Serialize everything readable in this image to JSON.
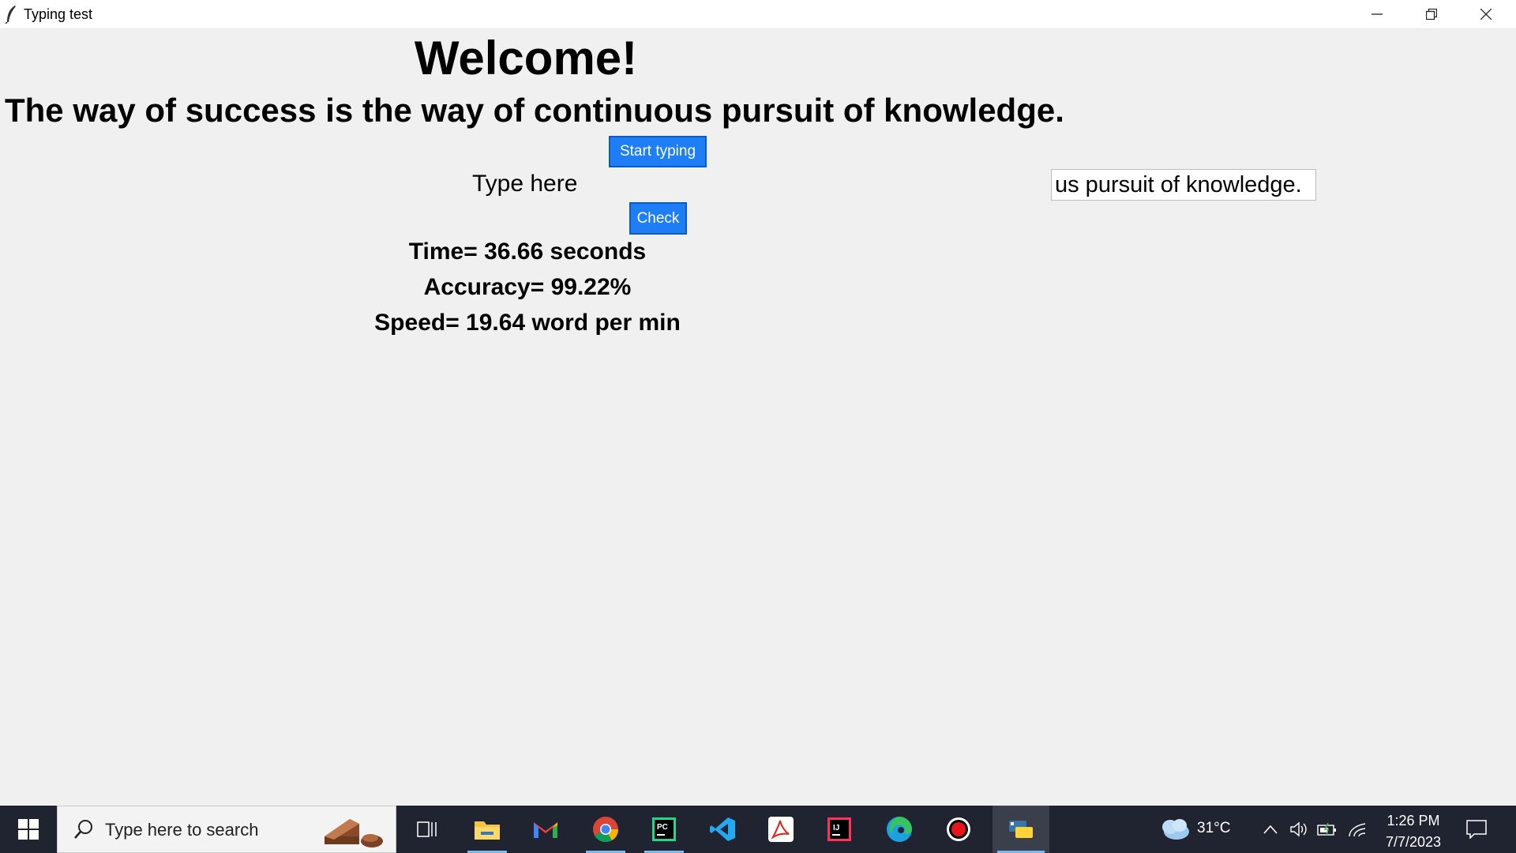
{
  "window": {
    "title": "Typing test"
  },
  "app": {
    "heading": "Welcome!",
    "quote": "The way of success is the way of continuous pursuit of knowledge.",
    "start_button": "Start typing",
    "type_label": "Type here",
    "input_value": "us pursuit of knowledge.",
    "check_button": "Check",
    "time_result": "Time= 36.66 seconds",
    "accuracy_result": "Accuracy= 99.22%",
    "speed_result": "Speed= 19.64 word per min"
  },
  "taskbar": {
    "search_placeholder": "Type here to search",
    "weather_temp": "31°C",
    "time": "1:26 PM",
    "date": "7/7/2023",
    "pinned": [
      "task-view",
      "file-explorer",
      "gmail",
      "chrome",
      "pycharm",
      "vscode",
      "adobe-reader",
      "intellij",
      "edge",
      "recorder",
      "python"
    ]
  },
  "colors": {
    "button_blue": "#1e7ef6",
    "window_bg": "#f0f0f0",
    "taskbar_bg": "#1f2430"
  }
}
